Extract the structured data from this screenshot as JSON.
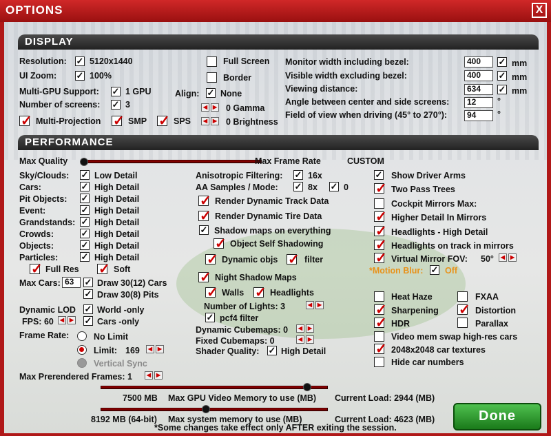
{
  "window": {
    "title": "OPTIONS",
    "close_glyph": "X"
  },
  "display": {
    "header": "DISPLAY",
    "resolution_label": "Resolution:",
    "resolution_value": "5120x1440",
    "ui_zoom_label": "UI Zoom:",
    "ui_zoom_value": "100%",
    "multigpu_label": "Multi-GPU Support:",
    "multigpu_value": "1 GPU",
    "screens_label": "Number of screens:",
    "screens_value": "3",
    "multi_projection": "Multi-Projection",
    "smp": "SMP",
    "sps": "SPS",
    "full_screen": "Full Screen",
    "border": "Border",
    "align_label": "Align:",
    "align_value": "None",
    "gamma": "0  Gamma",
    "brightness": "0  Brightness",
    "monitor_width_label": "Monitor width including bezel:",
    "monitor_width_value": "400",
    "visible_width_label": "Visible width excluding bezel:",
    "visible_width_value": "400",
    "viewing_distance_label": "Viewing distance:",
    "viewing_distance_value": "634",
    "angle_label": "Angle between center and side screens:",
    "angle_value": "12",
    "fov_label": "Field of view when driving (45° to 270°):",
    "fov_value": "94",
    "unit_mm": "mm",
    "unit_deg": "°"
  },
  "performance": {
    "header": "PERFORMANCE",
    "max_quality": "Max Quality",
    "max_frame_rate": "Max Frame Rate",
    "custom": "CUSTOM",
    "detail_rows": [
      {
        "label": "Sky/Clouds:",
        "value": "Low Detail"
      },
      {
        "label": "Cars:",
        "value": "High Detail"
      },
      {
        "label": "Pit Objects:",
        "value": "High Detail"
      },
      {
        "label": "Event:",
        "value": "High Detail"
      },
      {
        "label": "Grandstands:",
        "value": "High Detail"
      },
      {
        "label": "Crowds:",
        "value": "High Detail"
      },
      {
        "label": "Objects:",
        "value": "High Detail"
      },
      {
        "label": "Particles:",
        "value": "High Detail"
      }
    ],
    "full_res": "Full Res",
    "soft": "Soft",
    "max_cars_label": "Max Cars:",
    "max_cars_value": "63",
    "draw_cars": "Draw 30(12) Cars",
    "draw_pits": "Draw 30(8) Pits",
    "dynamic_lod": "Dynamic LOD",
    "world_only": "World -only",
    "fps": "FPS: 60",
    "cars_only": "Cars -only",
    "frame_rate_label": "Frame Rate:",
    "no_limit": "No Limit",
    "limit_label": "Limit:",
    "limit_value": "169",
    "vertical_sync": "Vertical Sync",
    "prerendered": "Max Prerendered Frames: 1",
    "aniso_label": "Anisotropic Filtering:",
    "aniso_value": "16x",
    "aa_label": "AA Samples / Mode:",
    "aa_value": "8x",
    "aa_mode": "0",
    "render_track": "Render Dynamic Track Data",
    "render_tire": "Render Dynamic Tire Data",
    "shadow_maps": "Shadow maps on everything",
    "self_shadowing": "Object Self Shadowing",
    "dynamic_objs": "Dynamic objs",
    "filter": "filter",
    "night_shadow": "Night Shadow Maps",
    "walls": "Walls",
    "headlights": "Headlights",
    "num_lights": "Number of Lights: 3",
    "pcf4": "pcf4 filter",
    "dyn_cubemaps": "Dynamic Cubemaps: 0",
    "fixed_cubemaps": "Fixed Cubemaps: 0",
    "shader_label": "Shader Quality:",
    "shader_value": "High Detail",
    "show_arms": "Show Driver Arms",
    "two_pass": "Two Pass Trees",
    "cockpit_mirrors": "Cockpit Mirrors  Max:",
    "higher_detail_mirrors": "Higher Detail In Mirrors",
    "headlights_high": "Headlights - High Detail",
    "headlights_mirrors": "Headlights on track in mirrors",
    "virtual_mirror": "Virtual Mirror   FOV:",
    "vm_fov": "50°",
    "motion_blur": "*Motion Blur:",
    "motion_blur_value": "Off",
    "heat_haze": "Heat Haze",
    "fxaa": "FXAA",
    "sharpening": "Sharpening",
    "distortion": "Distortion",
    "hdr": "HDR",
    "parallax": "Parallax",
    "vmem_swap": "Video mem swap high-res cars",
    "car_textures": "2048x2048 car textures",
    "hide_numbers": "Hide car numbers",
    "gpu_mem_value": "7500 MB",
    "gpu_mem_label": "Max GPU Video Memory to use (MB)",
    "gpu_load": "Current Load: 2944 (MB)",
    "sys_mem_value": "8192 MB (64-bit)",
    "sys_mem_label": "Max system memory to use (MB)",
    "sys_load": "Current Load: 4623 (MB)",
    "footer_note": "*Some changes take effect only AFTER exiting the session."
  },
  "buttons": {
    "done": "Done"
  },
  "colors": {
    "accent": "#c00000",
    "title_bar": "#b01818",
    "done_green": "#2e9a2e",
    "orange": "#e8921a"
  }
}
